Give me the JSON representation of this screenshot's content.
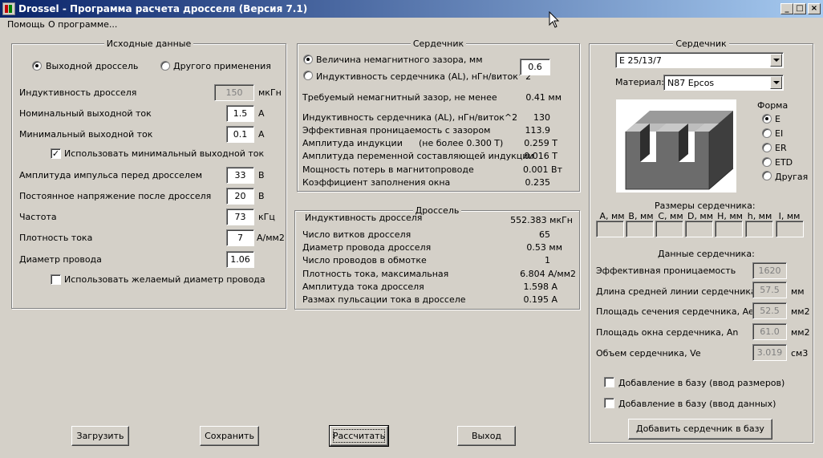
{
  "window": {
    "title": "Drossel - Программа расчета дросселя (Версия 7.1)",
    "minimize_glyph": "_",
    "maximize_glyph": "□",
    "close_glyph": "×"
  },
  "menu": {
    "help": "Помощь",
    "about": "О программе..."
  },
  "input_panel": {
    "title": "Исходные данные",
    "radio_output": "Выходной дроссель",
    "radio_other": "Другого применения",
    "inductance_label": "Индуктивность  дросселя",
    "inductance_value": "150",
    "inductance_unit": "мкГн",
    "nominal_current_label": "Номинальный выходной ток",
    "nominal_current_value": "1.5",
    "nominal_current_unit": "А",
    "min_current_label": "Минимальный выходной ток",
    "min_current_value": "0.1",
    "min_current_unit": "А",
    "use_min_current_label": "Использовать минимальный выходной ток",
    "use_min_current_mark": "✓",
    "pulse_amplitude_label": "Амплитуда импульса перед дросселем",
    "pulse_amplitude_value": "33",
    "pulse_amplitude_unit": "В",
    "dc_voltage_label": "Постоянное напряжение после дросселя",
    "dc_voltage_value": "20",
    "dc_voltage_unit": "В",
    "frequency_label": "Частота",
    "frequency_value": "73",
    "frequency_unit": "кГц",
    "current_density_label": "Плотность тока",
    "current_density_value": "7",
    "current_density_unit": "А/мм2",
    "wire_diameter_label": "Диаметр провода",
    "wire_diameter_value": "1.06",
    "use_wire_diameter_label": "Использовать желаемый диаметр провода"
  },
  "core_calc_panel": {
    "title": "Сердечник",
    "radio_gap_label": "Величина немагнитного зазора, мм",
    "radio_al_label": "Индуктивность сердечника (AL), нГн/виток^2",
    "gap_value": "0.6",
    "rows": [
      {
        "label": "Требуемый немагнитный зазор, не менее",
        "value": "0.41 мм"
      },
      {
        "label": "Индуктивность сердечника (AL), нГн/виток^2",
        "value": "130"
      },
      {
        "label": "Эффективная проницаемость с зазором",
        "value": "113.9"
      },
      {
        "label": "Амплитуда индукции",
        "note": "(не более 0.300 Т)",
        "value": "0.259 Т"
      },
      {
        "label": "Амплитуда переменной составляющей индукции",
        "value": "0.016 Т"
      },
      {
        "label": "Мощность потерь в магнитопроводе",
        "value": "0.001 Вт"
      },
      {
        "label": "Коэффициент заполнения окна",
        "value": "0.235"
      }
    ]
  },
  "choke_panel": {
    "title": "Дроссель",
    "rows": [
      {
        "label": "Индуктивность дросселя",
        "value": "552.383 мкГн"
      },
      {
        "label": "Число витков дросселя",
        "value": "65"
      },
      {
        "label": "Диаметр провода дросселя",
        "value": "0.53 мм"
      },
      {
        "label": "Число проводов в обмотке",
        "value": "1"
      },
      {
        "label": "Плотность тока, максимальная",
        "value": "6.804 А/мм2"
      },
      {
        "label": "Амплитуда тока дросселя",
        "value": "1.598 А"
      },
      {
        "label": "Размах пульсации тока в дросселе",
        "value": "0.195 А"
      }
    ]
  },
  "core_select_panel": {
    "title": "Сердечник",
    "core_type": "E 25/13/7",
    "material_label": "Материал:",
    "material_value": "N87 Epcos",
    "shape_label": "Форма",
    "shapes": [
      "E",
      "EI",
      "ER",
      "ETD",
      "Другая"
    ],
    "dimensions_label": "Размеры сердечника:",
    "dimension_headers": [
      "А, мм",
      "В, мм",
      "С, мм",
      "D, мм",
      "H, мм",
      "h, мм",
      "I, мм"
    ],
    "core_data_label": "Данные сердечника:",
    "params": [
      {
        "label": "Эффективная проницаемость",
        "value": "1620",
        "unit": ""
      },
      {
        "label": "Длина средней линии сердечника, le",
        "value": "57.5",
        "unit": "мм"
      },
      {
        "label": "Площадь сечения сердечника, Ae",
        "value": "52.5",
        "unit": "мм2"
      },
      {
        "label": "Площадь окна сердечника, An",
        "value": "61.0",
        "unit": "мм2"
      },
      {
        "label": "Объем сердечника, Ve",
        "value": "3.019",
        "unit": "см3"
      }
    ],
    "add_dimensions_label": "Добавление в базу (ввод размеров)",
    "add_data_label": "Добавление в базу (ввод данных)",
    "add_core_button": "Добавить сердечник в базу"
  },
  "buttons": {
    "load": "Загрузить",
    "save": "Сохранить",
    "calculate": "Рассчитать",
    "exit": "Выход"
  }
}
